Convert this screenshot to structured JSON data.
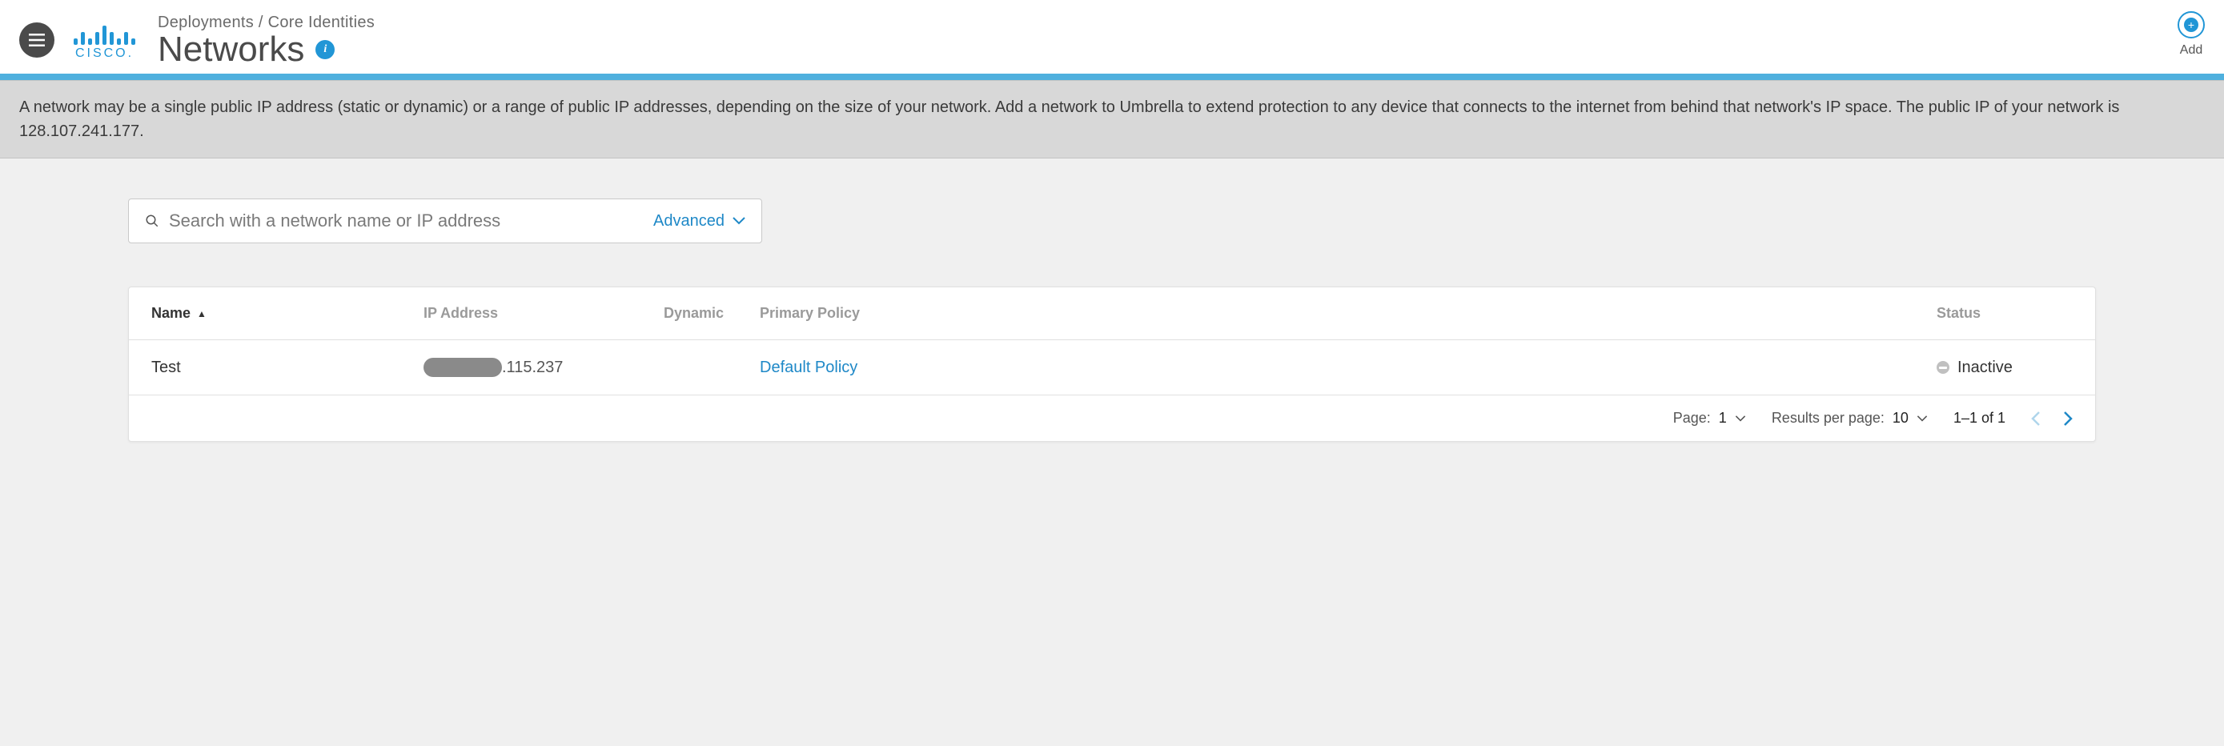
{
  "header": {
    "breadcrumb": "Deployments / Core Identities",
    "title": "Networks",
    "add_label": "Add"
  },
  "banner": {
    "text": "A network may be a single public IP address (static or dynamic) or a range of public IP addresses, depending on the size of your network. Add a network to Umbrella to extend protection to any device that connects to the internet from behind that network's IP space. The public IP of your network is 128.107.241.177."
  },
  "search": {
    "placeholder": "Search with a network name or IP address",
    "advanced_label": "Advanced"
  },
  "table": {
    "columns": {
      "name": "Name",
      "ip": "IP Address",
      "dynamic": "Dynamic",
      "policy": "Primary Policy",
      "status": "Status"
    },
    "rows": [
      {
        "name": "Test",
        "ip_suffix": ".115.237",
        "policy": "Default Policy",
        "status": "Inactive"
      }
    ]
  },
  "pagination": {
    "page_label": "Page:",
    "page_value": "1",
    "results_label": "Results per page:",
    "results_value": "10",
    "range": "1–1 of 1"
  }
}
